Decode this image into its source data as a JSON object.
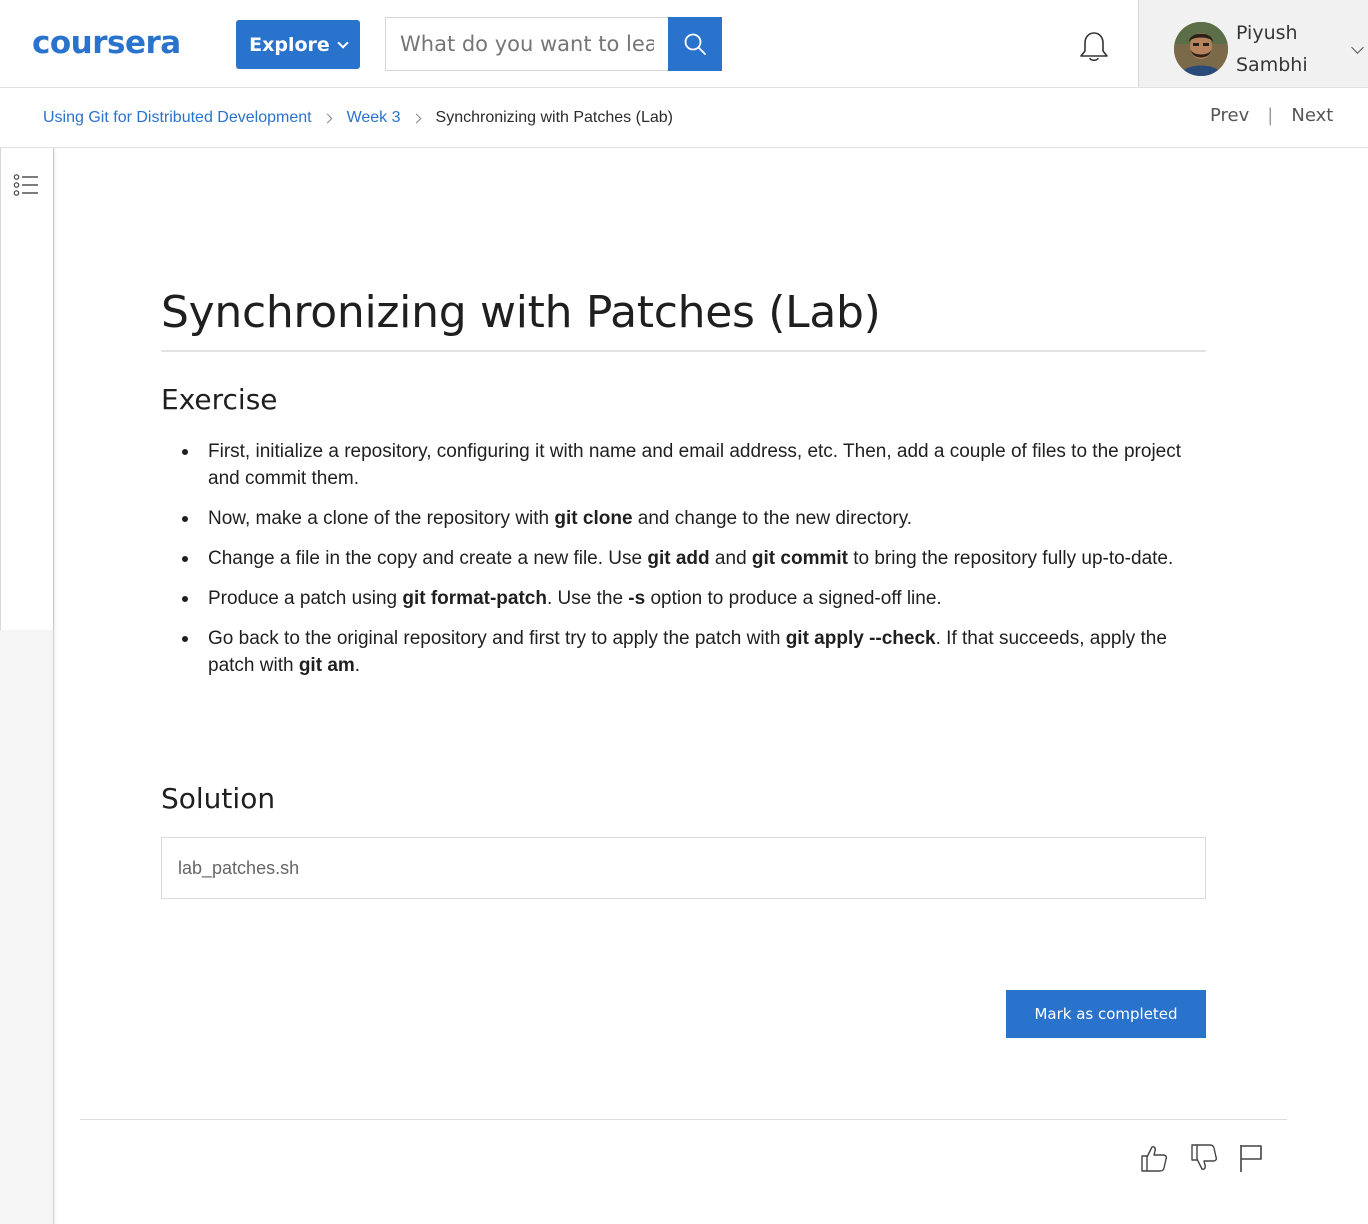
{
  "header": {
    "logo_text": "coursera",
    "explore_label": "Explore",
    "search_placeholder": "What do you want to learn?",
    "user_first": "Piyush",
    "user_last": "Sambhi"
  },
  "breadcrumb": {
    "course": "Using Git for Distributed Development",
    "week": "Week 3",
    "current": "Synchronizing with Patches (Lab)"
  },
  "nav": {
    "prev": "Prev",
    "separator": "|",
    "next": "Next"
  },
  "main": {
    "title": "Synchronizing with Patches (Lab)",
    "exercise_heading": "Exercise",
    "exercise_items": [
      {
        "parts": [
          {
            "text": "First, initialize a repository, configuring it with name and email address, etc. Then, add a couple of files to the project and commit them.",
            "bold": false
          }
        ]
      },
      {
        "parts": [
          {
            "text": "Now, make a clone of the repository with ",
            "bold": false
          },
          {
            "text": "git clone",
            "bold": true
          },
          {
            "text": " and change to the new directory.",
            "bold": false
          }
        ]
      },
      {
        "parts": [
          {
            "text": "Change a file in the copy and create a new file. Use ",
            "bold": false
          },
          {
            "text": "git add",
            "bold": true
          },
          {
            "text": " and ",
            "bold": false
          },
          {
            "text": "git commit",
            "bold": true
          },
          {
            "text": " to bring the repository fully up-to-date.",
            "bold": false
          }
        ]
      },
      {
        "parts": [
          {
            "text": "Produce a patch using ",
            "bold": false
          },
          {
            "text": "git format-patch",
            "bold": true
          },
          {
            "text": ". Use the ",
            "bold": false
          },
          {
            "text": "-s",
            "bold": true
          },
          {
            "text": " option to produce a signed-off line.",
            "bold": false
          }
        ]
      },
      {
        "parts": [
          {
            "text": "Go back to the original repository and first try to apply the patch with ",
            "bold": false
          },
          {
            "text": "git apply --check",
            "bold": true
          },
          {
            "text": ". If that succeeds, apply the patch with ",
            "bold": false
          },
          {
            "text": "git am",
            "bold": true
          },
          {
            "text": ".",
            "bold": false
          }
        ]
      }
    ],
    "solution_heading": "Solution",
    "solution_file": "lab_patches.sh",
    "complete_label": "Mark as completed"
  },
  "icons": {
    "search": "search-icon",
    "bell": "bell-icon",
    "toc": "list-icon",
    "like": "thumbs-up-icon",
    "dislike": "thumbs-down-icon",
    "flag": "flag-icon"
  },
  "colors": {
    "accent": "#2a73cc",
    "text": "#1f1f1f"
  }
}
